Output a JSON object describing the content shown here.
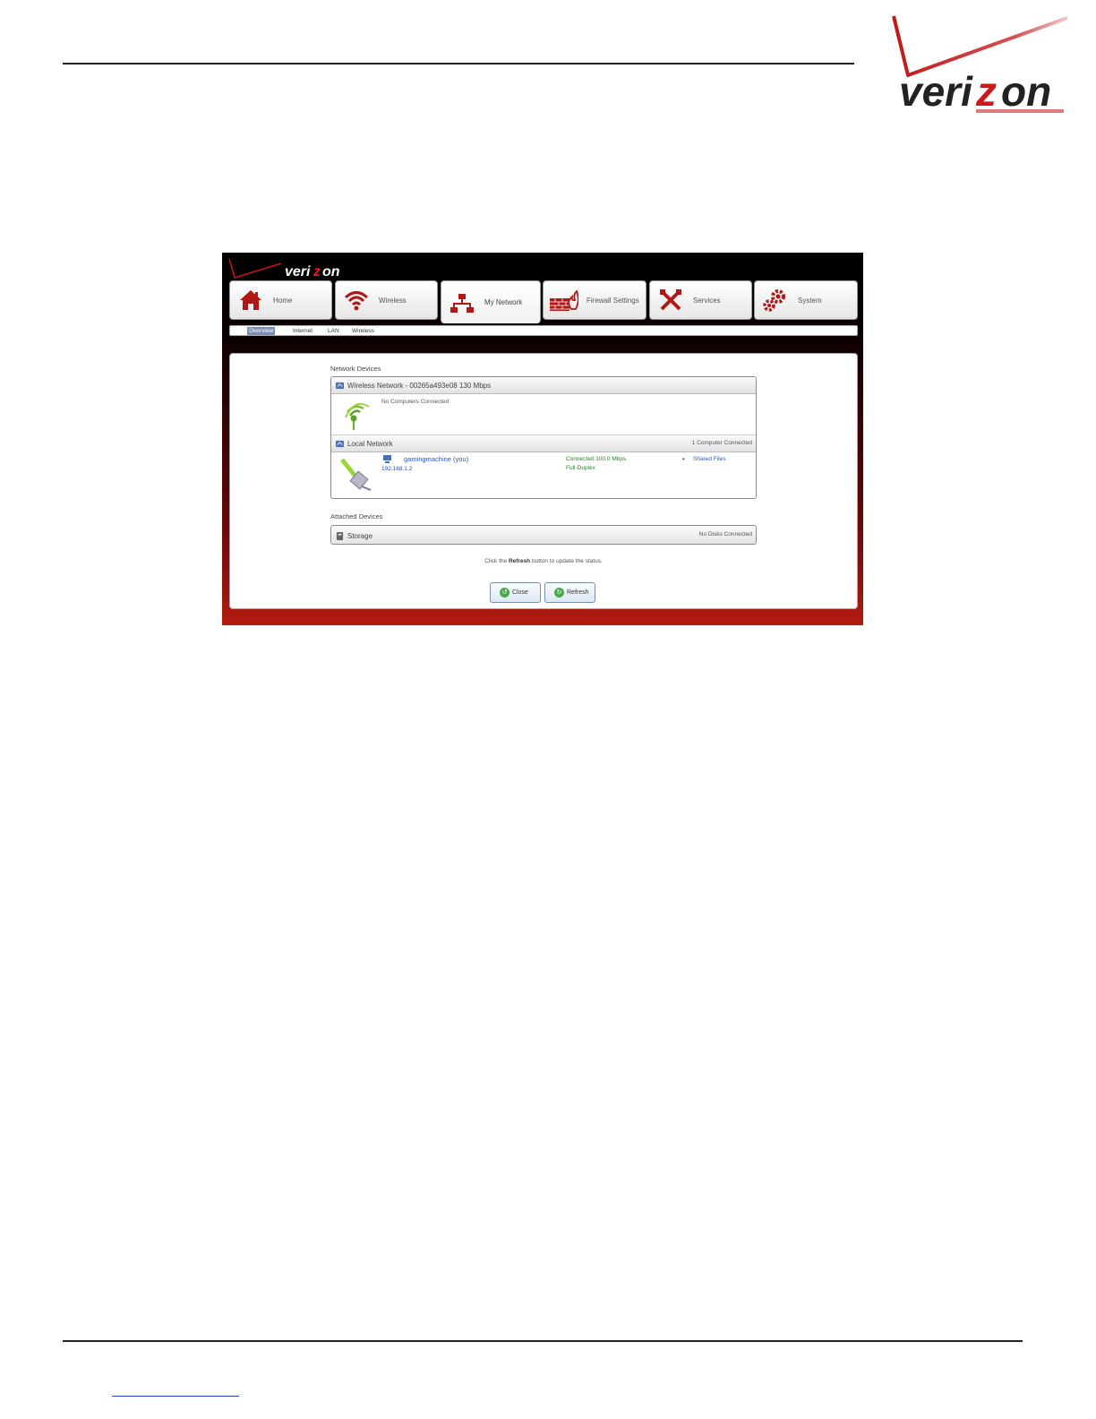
{
  "brand": {
    "name": "verizon"
  },
  "nav": {
    "tabs": [
      {
        "label": "Home",
        "icon": "home-icon"
      },
      {
        "label": "Wireless",
        "icon": "wireless-icon"
      },
      {
        "label": "My Network",
        "icon": "network-icon",
        "active": true
      },
      {
        "label": "Firewall Settings",
        "icon": "firewall-icon"
      },
      {
        "label": "Services",
        "icon": "services-icon"
      },
      {
        "label": "System",
        "icon": "gear-icon"
      }
    ],
    "subtabs": [
      {
        "label": "Overview",
        "selected": true
      },
      {
        "label": "Internet"
      },
      {
        "label": "LAN"
      },
      {
        "label": "Wireless"
      }
    ]
  },
  "network_devices": {
    "title": "Network Devices",
    "wireless": {
      "header": "Wireless Network - 00265a493e08 130 Mbps",
      "status": "No Computers Connected"
    },
    "local": {
      "header": "Local Network",
      "count": "1 Computer Connected",
      "device": {
        "name": "gamingmachine (you)",
        "ip": "192.168.1.2",
        "connection": "Connected 100.0 Mbps",
        "duplex": "Full-Duplex",
        "share": "Shared Files"
      }
    }
  },
  "attached_devices": {
    "title": "Attached Devices",
    "storage": {
      "label": "Storage",
      "status": "No Disks Connected"
    }
  },
  "hint": {
    "prefix": "Click the ",
    "keyword": "Refresh",
    "suffix": " button to update the status."
  },
  "buttons": {
    "close": "Close",
    "refresh": "Refresh"
  },
  "colors": {
    "brand_red": "#cc1a1a",
    "accent_green": "#1e8a1e",
    "link_blue": "#2858b8"
  }
}
